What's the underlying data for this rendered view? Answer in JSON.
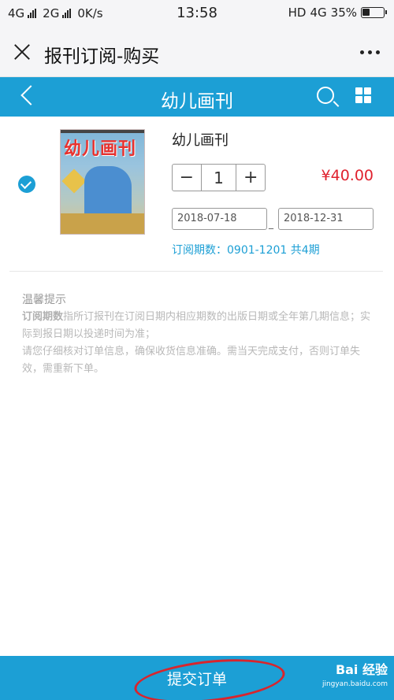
{
  "status_bar": {
    "network1": "4G",
    "network2": "2G",
    "speed": "0K/s",
    "time": "13:58",
    "hd": "HD",
    "network3": "4G",
    "battery": "35%"
  },
  "wechat_header": {
    "title": "报刊订阅-购买"
  },
  "nav": {
    "title": "幼儿画刊"
  },
  "product": {
    "name": "幼儿画刊",
    "cover_text": "幼儿画刊",
    "quantity": "1",
    "price": "¥40.00",
    "start_date": "2018-07-18",
    "dash": "_",
    "end_date": "2018-12-31",
    "periods": "订阅期数：0901-1201 共4期",
    "selected": true
  },
  "tips": {
    "title": "温馨提示",
    "line1_bold": "订阅期数",
    "line1_rest": "指所订报刊在订阅日期内相应期数的出版日期或全年第几期信息；实际到报日期以投递时间为准；",
    "line2": "请您仔细核对订单信息，确保收货信息准确。需当天完成支付，否则订单失效，需重新下单。"
  },
  "bottom_bar": {
    "submit_label": "提交订单",
    "watermark_top": "Bai 经验",
    "watermark_bottom": "jingyan.baidu.com"
  },
  "colors": {
    "accent": "#1c9fd5",
    "price": "#e0212e",
    "annotation_circle": "#d8252d"
  }
}
